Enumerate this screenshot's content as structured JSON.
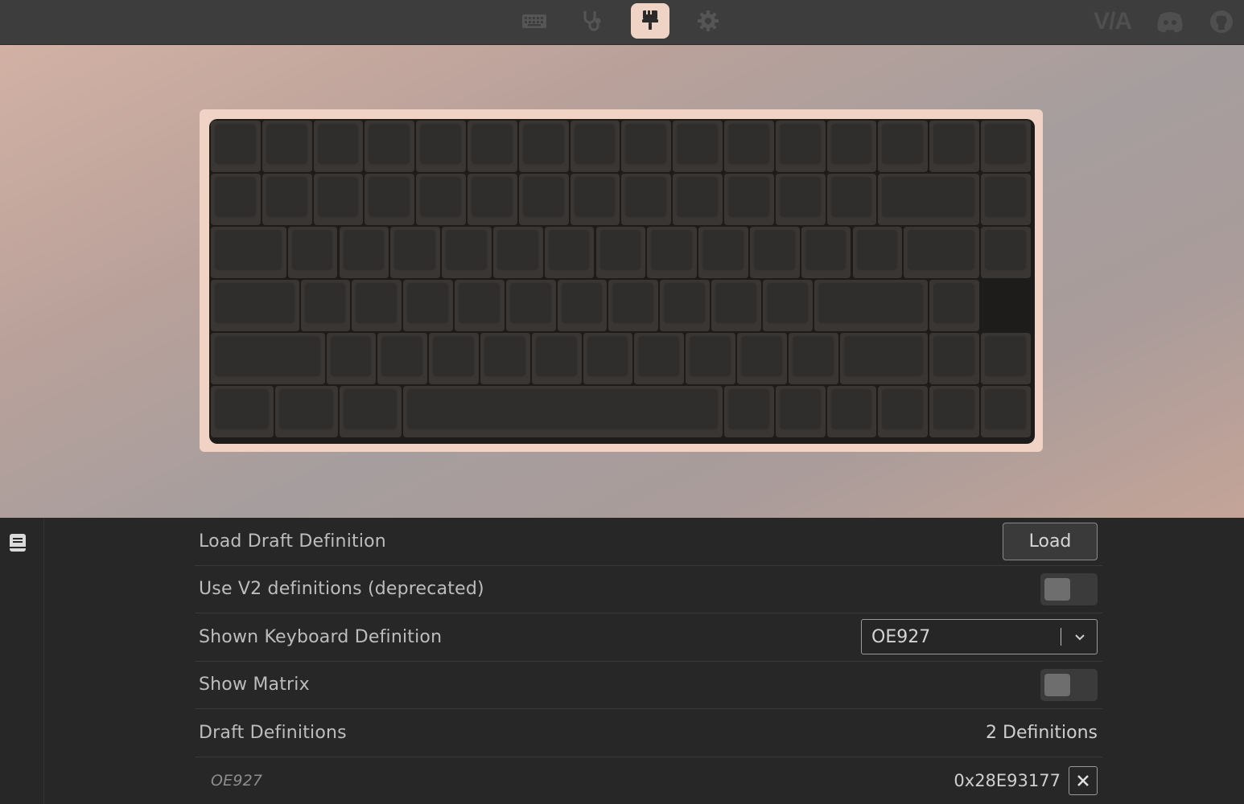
{
  "topbar": {
    "nav": [
      {
        "icon": "keyboard-icon",
        "active": false
      },
      {
        "icon": "stethoscope-icon",
        "active": false
      },
      {
        "icon": "paintbrush-icon",
        "active": true
      },
      {
        "icon": "gear-icon",
        "active": false
      }
    ],
    "via_logo": "V/A",
    "right_icons": [
      "discord-icon",
      "github-icon"
    ]
  },
  "keyboard": {
    "layout": "75%",
    "case_color": "#f1d3c6",
    "keycap_color": "#393634"
  },
  "settings": {
    "load_draft": {
      "label": "Load Draft Definition",
      "button": "Load"
    },
    "use_v2": {
      "label": "Use V2 definitions (deprecated)",
      "enabled": false
    },
    "shown_definition": {
      "label": "Shown Keyboard Definition",
      "value": "OE927"
    },
    "show_matrix": {
      "label": "Show Matrix",
      "enabled": false
    },
    "draft_definitions": {
      "label": "Draft Definitions",
      "count": "2 Definitions"
    },
    "definitions": [
      {
        "name": "OE927",
        "id": "0x28E93177"
      }
    ]
  }
}
